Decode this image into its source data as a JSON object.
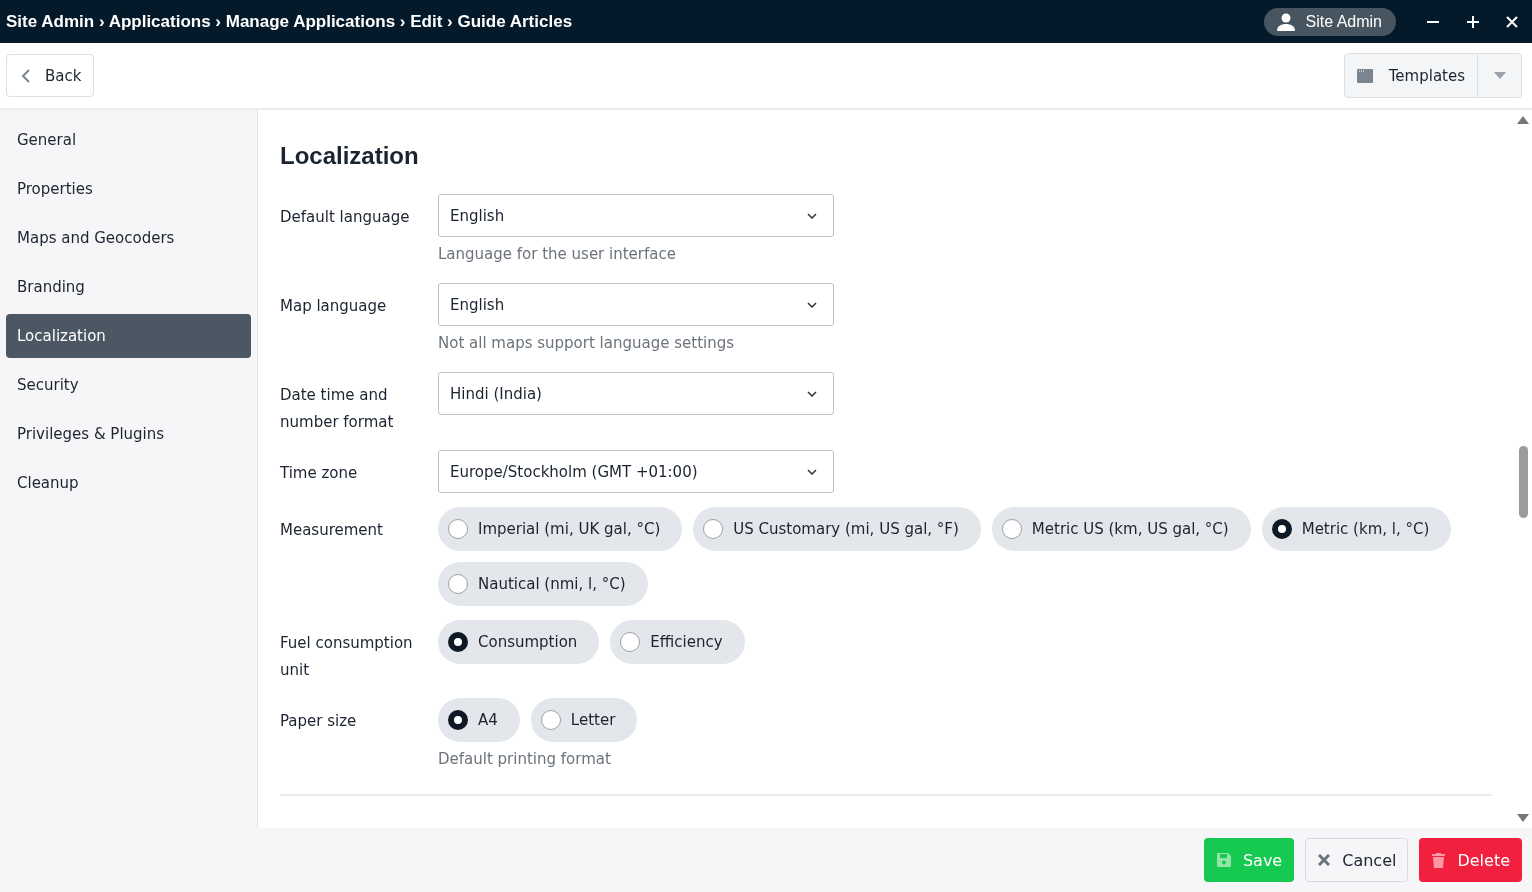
{
  "titlebar": {
    "breadcrumb": "Site Admin › Applications › Manage Applications › Edit › Guide Articles",
    "user": "Site Admin"
  },
  "toolbar": {
    "back": "Back",
    "templates": "Templates"
  },
  "sidebar": {
    "items": [
      {
        "label": "General",
        "selected": false
      },
      {
        "label": "Properties",
        "selected": false
      },
      {
        "label": "Maps and Geocoders",
        "selected": false
      },
      {
        "label": "Branding",
        "selected": false
      },
      {
        "label": "Localization",
        "selected": true
      },
      {
        "label": "Security",
        "selected": false
      },
      {
        "label": "Privileges & Plugins",
        "selected": false
      },
      {
        "label": "Cleanup",
        "selected": false
      }
    ]
  },
  "section": {
    "title": "Localization",
    "fields": [
      {
        "kind": "select",
        "label": "Default language",
        "value": "English",
        "hint": "Language for the user interface"
      },
      {
        "kind": "select",
        "label": "Map language",
        "value": "English",
        "hint": "Not all maps support language settings"
      },
      {
        "kind": "select",
        "label": "Date time and number format",
        "value": "Hindi (India)"
      },
      {
        "kind": "select",
        "label": "Time zone",
        "value": "Europe/Stockholm (GMT +01:00)"
      },
      {
        "kind": "radio",
        "label": "Measurement",
        "options": [
          {
            "label": "Imperial (mi, UK gal, °C)",
            "selected": false
          },
          {
            "label": "US Customary (mi, US gal, °F)",
            "selected": false
          },
          {
            "label": "Metric US (km, US gal, °C)",
            "selected": false
          },
          {
            "label": "Metric (km, l, °C)",
            "selected": true
          },
          {
            "label": "Nautical (nmi, l, °C)",
            "selected": false
          }
        ]
      },
      {
        "kind": "radio",
        "label": "Fuel consumption unit",
        "options": [
          {
            "label": "Consumption",
            "selected": true
          },
          {
            "label": "Efficiency",
            "selected": false
          }
        ]
      },
      {
        "kind": "radio",
        "label": "Paper size",
        "hint": "Default printing format",
        "options": [
          {
            "label": "A4",
            "selected": true
          },
          {
            "label": "Letter",
            "selected": false
          }
        ]
      }
    ]
  },
  "footer": {
    "save": "Save",
    "cancel": "Cancel",
    "delete": "Delete"
  }
}
